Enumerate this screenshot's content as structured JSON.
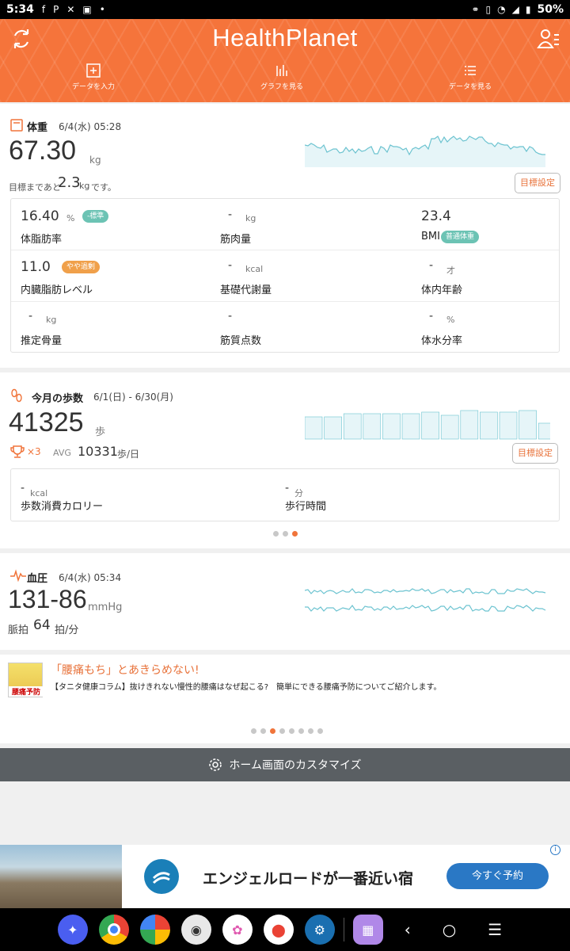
{
  "status": {
    "time": "5:34",
    "notif_icons": [
      "facebook-icon",
      "paypay-icon",
      "x-icon",
      "flipboard-icon",
      "dot-icon"
    ],
    "battery": "50%"
  },
  "header": {
    "logo": "HealthPlanet",
    "nav": [
      {
        "label": "データを入力",
        "icon": "add-data-icon"
      },
      {
        "label": "グラフを見る",
        "icon": "graph-icon"
      },
      {
        "label": "データを見る",
        "icon": "list-icon"
      }
    ]
  },
  "weight": {
    "title": "体重",
    "datetime": "6/4(水) 05:28",
    "value": "67.30",
    "unit": "kg",
    "goal_prefix": "目標まであと",
    "goal_value": "2.3",
    "goal_unit": "kg",
    "goal_suffix": "です。",
    "goal_button": "目標設定",
    "metrics": [
      {
        "value": "16.40",
        "unit": "%",
        "label": "体脂肪率",
        "badge": "-標準",
        "badge_color": "#6cc3b4"
      },
      {
        "value": "-",
        "unit": "kg",
        "label": "筋肉量",
        "badge": "",
        "badge_color": ""
      },
      {
        "value": "23.4",
        "unit": "",
        "label": "BMI",
        "badge": "普通体重",
        "badge_color": "#6cc3b4"
      },
      {
        "value": "11.0",
        "unit": "",
        "label": "内臓脂肪レベル",
        "badge": "やや過剰",
        "badge_color": "#f0a04a"
      },
      {
        "value": "-",
        "unit": "kcal",
        "label": "基礎代謝量",
        "badge": "",
        "badge_color": ""
      },
      {
        "value": "-",
        "unit": "才",
        "label": "体内年齢",
        "badge": "",
        "badge_color": ""
      },
      {
        "value": "-",
        "unit": "kg",
        "label": "推定骨量",
        "badge": "",
        "badge_color": ""
      },
      {
        "value": "-",
        "unit": "",
        "label": "筋質点数",
        "badge": "",
        "badge_color": ""
      },
      {
        "value": "-",
        "unit": "%",
        "label": "体水分率",
        "badge": "",
        "badge_color": ""
      }
    ]
  },
  "steps": {
    "title": "今月の歩数",
    "range": "6/1(日) - 6/30(月)",
    "value": "41325",
    "unit": "歩",
    "trophy_count": "×3",
    "avg_label": "AVG",
    "avg_value": "10331",
    "avg_unit": "歩/日",
    "goal_button": "目標設定",
    "calories": {
      "value": "-",
      "unit": "kcal",
      "label": "歩数消費カロリー"
    },
    "walktime": {
      "value": "-",
      "unit": "分",
      "label": "歩行時間"
    },
    "page_dots": 3,
    "active_dot": 2
  },
  "bp": {
    "title": "血圧",
    "datetime": "6/4(水) 05:34",
    "value": "131-86",
    "unit": "mmHg",
    "pulse_label": "脈拍",
    "pulse_value": "64",
    "pulse_unit": "拍/分"
  },
  "column": {
    "thumb_text": "腰痛予防",
    "title": "「腰痛もち」とあきらめない!",
    "body": "【タニタ健康コラム】抜けきれない慢性的腰痛はなぜ起こる?　簡単にできる腰痛予防についてご紹介します。",
    "page_dots": 8,
    "active_dot": 2
  },
  "customize": {
    "label": "ホーム画面のカスタマイズ"
  },
  "ad": {
    "text": "エンジェルロードが一番近い宿",
    "button": "今すぐ予約",
    "info": "i"
  },
  "colors": {
    "brand": "#f5743b",
    "chart": "#6cc3d0",
    "chart_fill": "#e6f5f8"
  }
}
